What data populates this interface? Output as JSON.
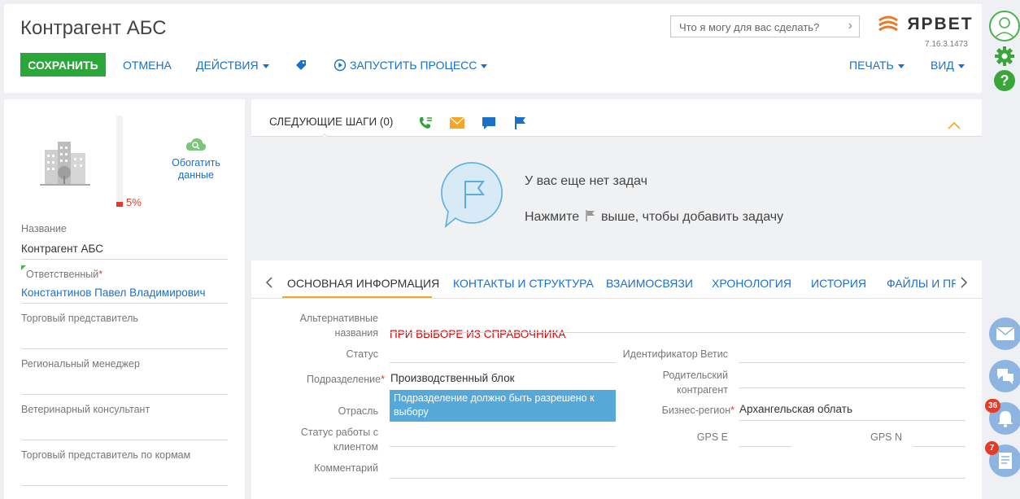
{
  "header": {
    "title": "Контрагент АБС",
    "save": "СОХРАНИТЬ",
    "cancel": "ОТМЕНА",
    "actions": "ДЕЙСТВИЯ",
    "run_process": "ЗАПУСТИТЬ ПРОЦЕСС",
    "print": "ПЕЧАТЬ",
    "view": "ВИД",
    "search_placeholder": "Что я могу для вас сделать?",
    "logo_text": "ЯРВЕТ",
    "version": "7.16.3.1473"
  },
  "profile": {
    "completeness": "5%",
    "completeness_value": 5,
    "enrich_label": "Обогатить данные",
    "fields": [
      {
        "label": "Название",
        "value": "Контрагент АБС"
      },
      {
        "label": "Ответственный",
        "value": "Константинов Павел Владимирович",
        "required": "*"
      },
      {
        "label": "Торговый представитель",
        "value": ""
      },
      {
        "label": "Региональный менеджер",
        "value": ""
      },
      {
        "label": "Ветеринарный консультант",
        "value": ""
      },
      {
        "label": "Торговый представитель по кормам",
        "value": ""
      }
    ]
  },
  "steps": {
    "title": "СЛЕДУЮЩИЕ ШАГИ (0)",
    "empty_title": "У вас еще нет задач",
    "hint_before": "Нажмите",
    "hint_after": "выше, чтобы добавить задачу"
  },
  "tabs": {
    "items": [
      {
        "label": "ОСНОВНАЯ ИНФОРМАЦИЯ",
        "active": true
      },
      {
        "label": "КОНТАКТЫ И СТРУКТУРА"
      },
      {
        "label": "ВЗАИМОСВЯЗИ"
      },
      {
        "label": "ХРОНОЛОГИЯ"
      },
      {
        "label": "ИСТОРИЯ"
      },
      {
        "label": "ФАЙЛЫ И ПРИМЕЧАНИЯ"
      }
    ]
  },
  "form": {
    "alt_names_label_1": "Альтернативные",
    "alt_names_label_2": "названия",
    "alt_names_value": "ПРИ ВЫБОРЕ ИЗ СПРАВОЧНИКА",
    "status_label": "Статус",
    "division_label": "Подразделение",
    "division_value": "Производственный блок",
    "division_tooltip": "Подразделение должно быть разрешено к выбору",
    "industry_label": "Отрасль",
    "client_status_label_1": "Статус работы с",
    "client_status_label_2": "клиентом",
    "comment_label": "Комментарий",
    "vetis_label": "Идентификатор Ветис",
    "parent_label_1": "Родительский",
    "parent_label_2": "контрагент",
    "region_label": "Бизнес-регион",
    "region_value": "Архангельская облать",
    "gps_e_label": "GPS E",
    "gps_n_label": "GPS N",
    "required_mark": "*"
  },
  "notifications": {
    "bell_count": "36",
    "feed_count": "7"
  },
  "colors": {
    "accent": "#1a6fc9",
    "save": "#2ba638",
    "required": "#e63b28",
    "tooltip": "#56a8d8"
  }
}
